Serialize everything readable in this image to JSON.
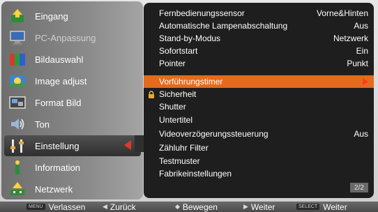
{
  "sidebar": {
    "items": [
      {
        "label": "Eingang",
        "icon": "input-icon",
        "dim": false
      },
      {
        "label": "PC-Anpassung",
        "icon": "pc-adjust-icon",
        "dim": true
      },
      {
        "label": "Bildauswahl",
        "icon": "image-select-icon",
        "dim": false
      },
      {
        "label": "Image adjust",
        "icon": "image-adjust-icon",
        "dim": false
      },
      {
        "label": "Format Bild",
        "icon": "screen-format-icon",
        "dim": false
      },
      {
        "label": "Ton",
        "icon": "sound-icon",
        "dim": false
      },
      {
        "label": "Einstellung",
        "icon": "settings-icon",
        "dim": false
      },
      {
        "label": "Information",
        "icon": "information-icon",
        "dim": false
      },
      {
        "label": "Netzwerk",
        "icon": "network-icon",
        "dim": false
      }
    ],
    "active_index": 6
  },
  "menu": {
    "rows": [
      {
        "label": "Fernbedienungssensor",
        "value": "Vorne&Hinten"
      },
      {
        "label": "Automatische Lampenabschaltung",
        "value": "Aus"
      },
      {
        "label": "Stand-by-Modus",
        "value": "Netzwerk"
      },
      {
        "label": "Sofortstart",
        "value": "Ein"
      },
      {
        "label": "Pointer",
        "value": "Punkt"
      },
      {
        "label": "Vorführungstimer",
        "value": ""
      },
      {
        "label": "Sicherheit",
        "value": ""
      },
      {
        "label": "Shutter",
        "value": ""
      },
      {
        "label": "Untertitel",
        "value": ""
      },
      {
        "label": "Videoverzögerungssteuerung",
        "value": "Aus"
      },
      {
        "label": "Zähluhr Filter",
        "value": ""
      },
      {
        "label": "Testmuster",
        "value": ""
      },
      {
        "label": "Fabrikeinstellungen",
        "value": ""
      }
    ],
    "selected_index": 5,
    "locked_index": 6,
    "page": "2/2"
  },
  "hints": {
    "menu_key": "MENU",
    "leave": "Verlassen",
    "back": "Zurück",
    "move": "Bewegen",
    "next": "Weiter",
    "select_key": "SELECT",
    "select_next": "Weiter"
  },
  "colors": {
    "accent": "#e56a1e",
    "arrow": "#e03a2a",
    "menu_bg": "#1e1e1e"
  }
}
